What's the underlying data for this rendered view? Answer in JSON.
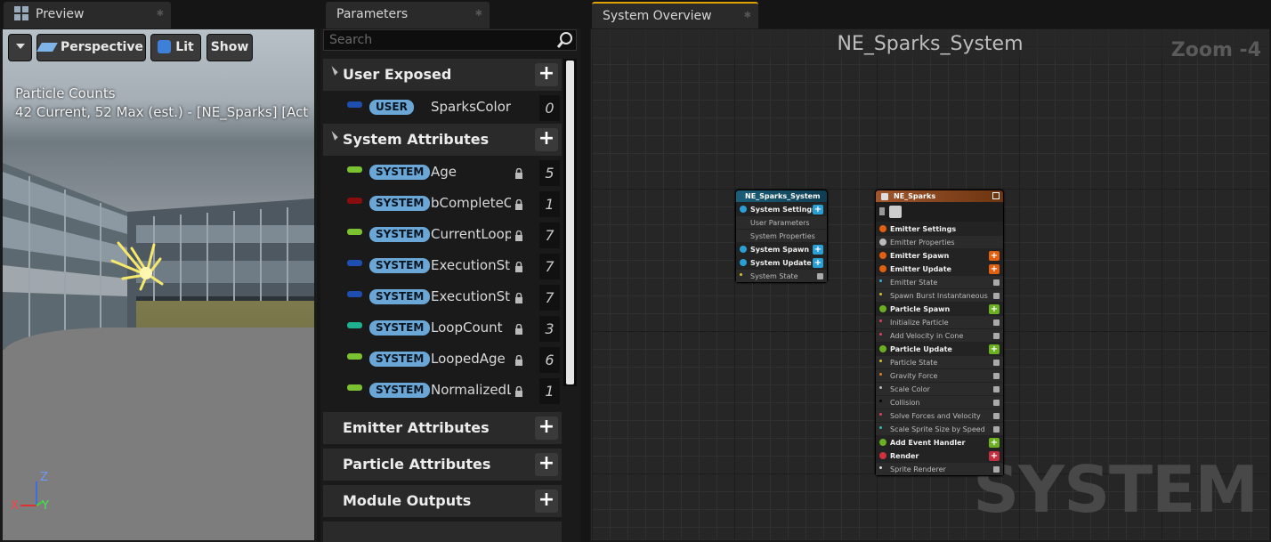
{
  "tabs": {
    "preview": "Preview",
    "parameters": "Parameters",
    "overview": "System Overview"
  },
  "viewport": {
    "perspective": "Perspective",
    "lit": "Lit",
    "show": "Show",
    "counts_label": "Particle Counts",
    "counts_value": "42 Current, 52 Max (est.) - [NE_Sparks] [Act",
    "axis_z": "Z",
    "axis_x": "X",
    "axis_y": "Y"
  },
  "parameters": {
    "search_placeholder": "Search",
    "user_exposed": "User Exposed",
    "user_params": [
      {
        "badge": "USER",
        "name": "SparksColor",
        "count": "0",
        "color": "#1e4fb0"
      }
    ],
    "system_attributes": "System Attributes",
    "system_params": [
      {
        "badge": "SYSTEM",
        "name": "Age",
        "count": "5",
        "color": "#7ac230"
      },
      {
        "badge": "SYSTEM",
        "name": "bCompleteOnI",
        "count": "1",
        "color": "#8a0d0d"
      },
      {
        "badge": "SYSTEM",
        "name": "CurrentLoopD",
        "count": "7",
        "color": "#7ac230"
      },
      {
        "badge": "SYSTEM",
        "name": "ExecutionState",
        "count": "7",
        "color": "#1e4fb0"
      },
      {
        "badge": "SYSTEM",
        "name": "ExecutionStateSource",
        "count": "7",
        "color": "#1e4fb0"
      },
      {
        "badge": "SYSTEM",
        "name": "LoopCount",
        "count": "3",
        "color": "#1fb08f"
      },
      {
        "badge": "SYSTEM",
        "name": "LoopedAge",
        "count": "6",
        "color": "#7ac230"
      },
      {
        "badge": "SYSTEM",
        "name": "NormalizedLoopAge",
        "count": "1",
        "color": "#7ac230"
      }
    ],
    "emitter_attributes": "Emitter Attributes",
    "particle_attributes": "Particle Attributes",
    "module_outputs": "Module Outputs"
  },
  "overview": {
    "title": "NE_Sparks_System",
    "zoom": "Zoom -4",
    "watermark": "SYSTEM",
    "system_node": {
      "title": "NE_Sparks_System",
      "rows": [
        {
          "label": "System Settings",
          "group": true,
          "icon": "#2a9fd6",
          "plus": "#2a9fd6"
        },
        {
          "label": "User Parameters",
          "group": false
        },
        {
          "label": "System Properties",
          "group": false
        },
        {
          "label": "System Spawn",
          "group": true,
          "icon": "#2a9fd6",
          "plus": "#2a9fd6"
        },
        {
          "label": "System Update",
          "group": true,
          "icon": "#2a9fd6",
          "plus": "#2a9fd6"
        },
        {
          "label": "System State",
          "group": false,
          "dot": "#d8c030",
          "check": true
        }
      ]
    },
    "emitter_node": {
      "title": "NE_Sparks",
      "rows": [
        {
          "label": "Emitter Settings",
          "group": true,
          "icon": "#e06010"
        },
        {
          "label": "Emitter Properties",
          "group": false,
          "icon": "#bbbbbb"
        },
        {
          "label": "Emitter Spawn",
          "group": true,
          "icon": "#e06010",
          "plus": "#e06010"
        },
        {
          "label": "Emitter Update",
          "group": true,
          "icon": "#e06010",
          "plus": "#e06010"
        },
        {
          "label": "Emitter State",
          "group": false,
          "dot": "#30b0e0",
          "check": true
        },
        {
          "label": "Spawn Burst Instantaneous",
          "group": false,
          "dot": "#d8c030",
          "check": true
        },
        {
          "label": "Particle Spawn",
          "group": true,
          "icon": "#6ab020",
          "plus": "#6ab020"
        },
        {
          "label": "Initialize Particle",
          "group": false,
          "dot": "#e04060",
          "check": true
        },
        {
          "label": "Add Velocity in Cone",
          "group": false,
          "dot": "#e04060",
          "check": true
        },
        {
          "label": "Particle Update",
          "group": true,
          "icon": "#6ab020",
          "plus": "#6ab020"
        },
        {
          "label": "Particle State",
          "group": false,
          "dot": "#d8c030",
          "check": true
        },
        {
          "label": "Gravity Force",
          "group": false,
          "dot": "#e08020",
          "check": true
        },
        {
          "label": "Scale Color",
          "group": false,
          "dot": "#bbbbbb",
          "check": true
        },
        {
          "label": "Collision",
          "group": false,
          "dot": "#000000",
          "check": true
        },
        {
          "label": "Solve Forces and Velocity",
          "group": false,
          "dot": "#e04060",
          "check": true
        },
        {
          "label": "Scale Sprite Size by Speed",
          "group": false,
          "dot": "#30c0b0",
          "check": true
        },
        {
          "label": "Add Event Handler",
          "group": true,
          "icon": "#6ab020",
          "plus": "#6ab020"
        },
        {
          "label": "Render",
          "group": true,
          "icon": "#d03040",
          "plus": "#c03040"
        },
        {
          "label": "Sprite Renderer",
          "group": false,
          "dot": "#dddddd",
          "check": true
        }
      ]
    }
  },
  "colors": {
    "accent": "#e0a200",
    "user_badge": "#6aa7d6"
  }
}
